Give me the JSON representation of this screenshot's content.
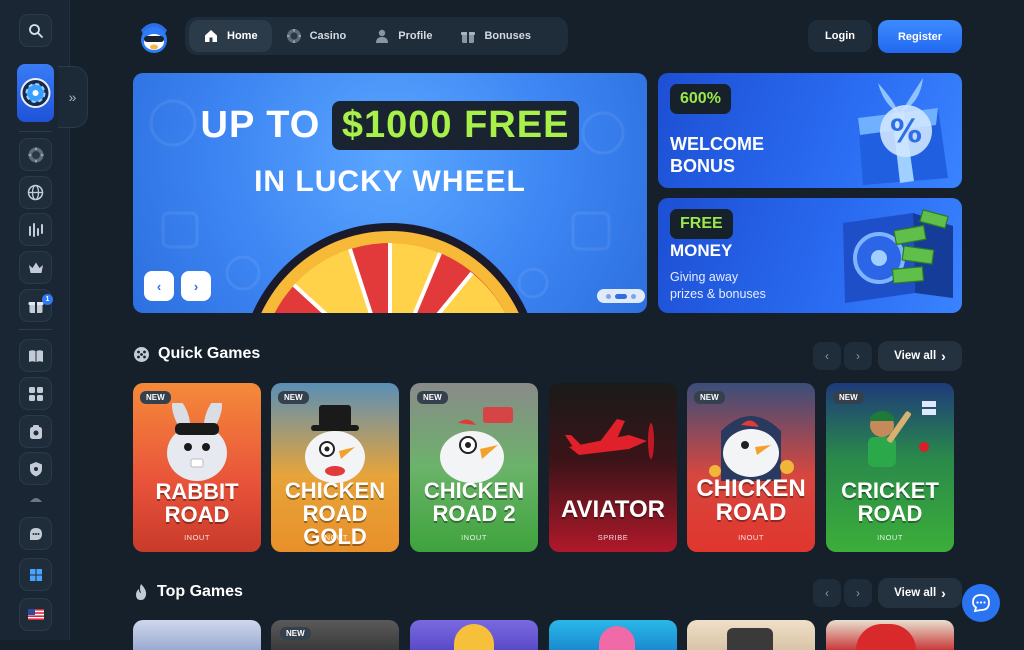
{
  "nav": {
    "items": [
      {
        "label": "Home",
        "icon": "home-icon",
        "active": true
      },
      {
        "label": "Casino",
        "icon": "casino-chip-icon",
        "active": false
      },
      {
        "label": "Profile",
        "icon": "user-icon",
        "active": false
      },
      {
        "label": "Bonuses",
        "icon": "gift-icon",
        "active": false
      }
    ],
    "login_label": "Login",
    "register_label": "Register"
  },
  "hero": {
    "line1_prefix": "UP TO",
    "line1_highlight": "$1000 FREE",
    "line2": "IN LUCKY WHEEL",
    "slides_total": 3,
    "active_slide": 2
  },
  "promos": [
    {
      "tag": "600%",
      "title_line1": "WELCOME",
      "title_line2": "BONUS"
    },
    {
      "tag": "FREE",
      "title_line1": "MONEY",
      "subtitle_line1": "Giving away",
      "subtitle_line2": "prizes & bonuses"
    }
  ],
  "quick_games": {
    "title": "Quick Games",
    "view_all": "View all",
    "games": [
      {
        "name_line1": "RABBIT",
        "name_line2": "ROAD",
        "provider": "INOUT",
        "badge": "NEW"
      },
      {
        "name_line1": "CHICKEN",
        "name_line2": "ROAD GOLD",
        "provider": "INOUT",
        "badge": "NEW"
      },
      {
        "name_line1": "CHICKEN",
        "name_line2": "ROAD 2",
        "provider": "INOUT",
        "badge": "NEW"
      },
      {
        "name_line1": "AVIATOR",
        "name_line2": "",
        "provider": "SPRIBE",
        "badge": ""
      },
      {
        "name_line1": "CHICKEN",
        "name_line2": "ROAD",
        "provider": "INOUT",
        "badge": "NEW"
      },
      {
        "name_line1": "CRICKET",
        "name_line2": "ROAD",
        "provider": "INOUT",
        "badge": "NEW"
      }
    ]
  },
  "top_games": {
    "title": "Top Games",
    "view_all": "View all",
    "badge_second": "NEW"
  },
  "sidebar": {
    "notification_count": "1",
    "icons": [
      "search-icon",
      "lucky-wheel-icon",
      "casino-chip-icon",
      "globe-icon",
      "signal-icon",
      "crown-icon",
      "gift-icon",
      "book-icon",
      "puzzle-icon",
      "bonus-icon",
      "shield-icon",
      "hat-icon",
      "support-icon",
      "windows-icon",
      "us-flag-icon"
    ]
  },
  "colors": {
    "background": "#15202b",
    "accent_blue": "#2a74f2",
    "highlight_green": "#9be84a"
  }
}
